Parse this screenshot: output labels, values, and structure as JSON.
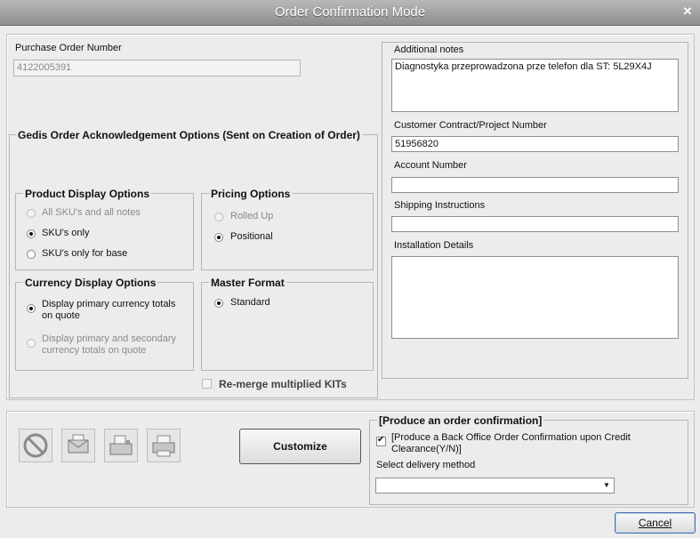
{
  "window": {
    "title": "Order Confirmation Mode"
  },
  "po": {
    "label": "Purchase Order Number",
    "value": "4122005391"
  },
  "notes": {
    "additional_label": "Additional notes",
    "additional_value": "Diagnostyka przeprowadzona prze telefon dla ST: 5L29X4J",
    "contract_label": "Customer Contract/Project Number",
    "contract_value": "51956820",
    "account_label": "Account Number",
    "account_value": "",
    "shipping_label": "Shipping Instructions",
    "shipping_value": "",
    "installation_label": "Installation Details",
    "installation_value": ""
  },
  "gedis": {
    "title": "Gedis Order Acknowledgement Options (Sent on Creation of Order)",
    "product": {
      "title": "Product Display Options",
      "opt1": "All SKU's and all notes",
      "opt2": "SKU's only",
      "opt3": "SKU's only for base"
    },
    "pricing": {
      "title": "Pricing Options",
      "opt1": "Rolled Up",
      "opt2": "Positional"
    },
    "currency": {
      "title": "Currency Display Options",
      "opt1": "Display primary currency totals on quote",
      "opt2": "Display primary and secondary currency totals on quote"
    },
    "master": {
      "title": "Master Format",
      "opt1": "Standard"
    },
    "remerge": "Re-merge multiplied KITs"
  },
  "actions": {
    "customize": "Customize",
    "cancel": "Cancel"
  },
  "produce": {
    "title": "[Produce an order confirmation]",
    "checkbox_label": "[Produce a Back Office Order Confirmation upon Credit Clearance(Y/N)]",
    "delivery_label": "Select delivery method",
    "delivery_value": ""
  }
}
